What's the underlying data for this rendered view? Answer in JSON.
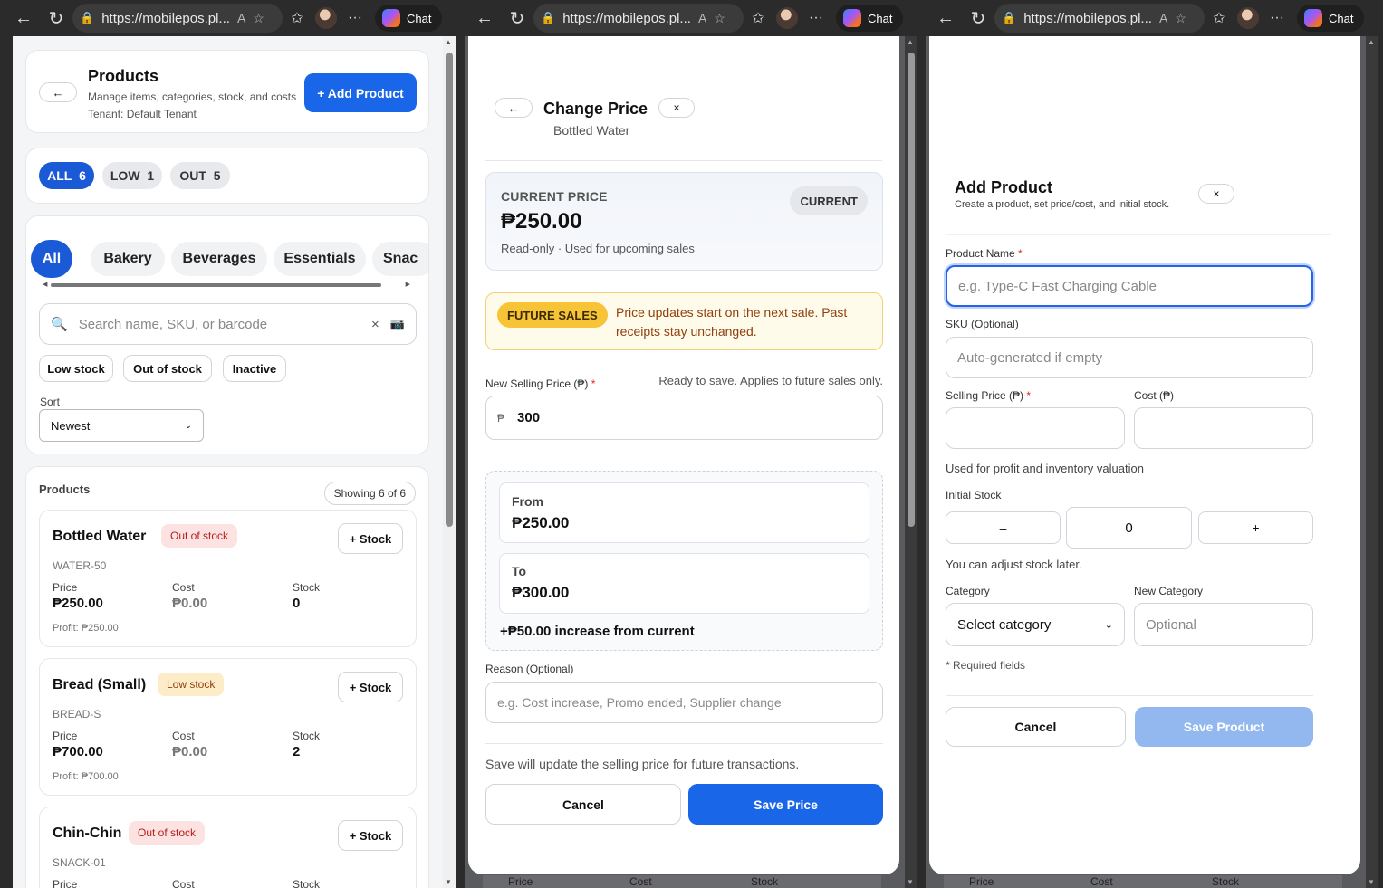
{
  "browser": {
    "url": "https://mobilepos.pl...",
    "chat_label": "Chat"
  },
  "products_page": {
    "title": "Products",
    "subtitle": "Manage items, categories, stock, and costs",
    "tenant": "Tenant: Default Tenant",
    "add_button": "+ Add Product",
    "back_label": "←",
    "filter_pills": [
      {
        "label": "ALL",
        "count": "6"
      },
      {
        "label": "LOW",
        "count": "1"
      },
      {
        "label": "OUT",
        "count": "5"
      }
    ],
    "categories": [
      "All",
      "Bakery",
      "Beverages",
      "Essentials",
      "Snac"
    ],
    "search_placeholder": "Search name, SKU, or barcode",
    "search_clear": "×",
    "quick_filters": [
      "Low stock",
      "Out of stock",
      "Inactive"
    ],
    "sort_label": "Sort",
    "sort_value": "Newest",
    "list_title": "Products",
    "showing": "Showing 6 of 6",
    "col_price": "Price",
    "col_cost": "Cost",
    "col_stock": "Stock",
    "stock_button": "+ Stock",
    "items": [
      {
        "name": "Bottled Water",
        "badge": "Out of stock",
        "sku": "WATER-50",
        "price": "₱250.00",
        "cost": "₱0.00",
        "stock": "0",
        "profit": "Profit: ₱250.00"
      },
      {
        "name": "Bread (Small)",
        "badge": "Low stock",
        "sku": "BREAD-S",
        "price": "₱700.00",
        "cost": "₱0.00",
        "stock": "2",
        "profit": "Profit: ₱700.00"
      },
      {
        "name": "Chin-Chin",
        "badge": "Out of stock",
        "sku": "SNACK-01"
      }
    ]
  },
  "change_price": {
    "back_label": "←",
    "title": "Change Price",
    "product": "Bottled Water",
    "close": "×",
    "current_label": "CURRENT PRICE",
    "current_price": "₱250.00",
    "current_note": "Read-only · Used for upcoming sales",
    "current_tag": "CURRENT",
    "future_tag": "FUTURE SALES",
    "future_text": "Price updates start on the next sale. Past receipts stay unchanged.",
    "new_price_label": "New Selling Price (₱)",
    "required": "*",
    "ready_text": "Ready to save. Applies to future sales only.",
    "currency": "₱",
    "new_price_value": "300",
    "from_label": "From",
    "from_value": "₱250.00",
    "to_label": "To",
    "to_value": "₱300.00",
    "delta": "+₱50.00 increase from current",
    "reason_label": "Reason (Optional)",
    "reason_placeholder": "e.g. Cost increase, Promo ended, Supplier change",
    "footer_note": "Save will update the selling price for future transactions.",
    "cancel": "Cancel",
    "save": "Save Price",
    "behind_cols": [
      "Price",
      "Cost",
      "Stock"
    ]
  },
  "add_product": {
    "title": "Add Product",
    "subtitle": "Create a product, set price/cost, and initial stock.",
    "close": "×",
    "name_label": "Product Name",
    "required": "*",
    "name_placeholder": "e.g. Type-C Fast Charging Cable",
    "sku_label": "SKU (Optional)",
    "sku_placeholder": "Auto-generated if empty",
    "price_label": "Selling Price (₱)",
    "cost_label": "Cost (₱)",
    "valuation_note": "Used for profit and inventory valuation",
    "initial_stock_label": "Initial Stock",
    "minus": "–",
    "stock_value": "0",
    "plus": "+",
    "stock_note": "You can adjust stock later.",
    "category_label": "Category",
    "category_value": "Select category",
    "new_category_label": "New Category",
    "new_category_placeholder": "Optional",
    "required_note": "* Required fields",
    "cancel": "Cancel",
    "save": "Save Product",
    "behind_cols": [
      "Price",
      "Cost",
      "Stock"
    ]
  }
}
